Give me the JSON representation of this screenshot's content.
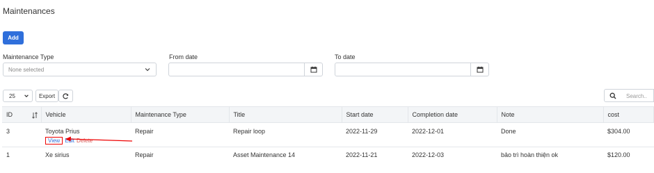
{
  "page": {
    "title": "Maintenances"
  },
  "toolbar": {
    "add_label": "Add"
  },
  "filters": {
    "type_label": "Maintenance Type",
    "type_placeholder": "None selected",
    "from_label": "From date",
    "to_label": "To date"
  },
  "table_tools": {
    "page_size": "25",
    "export_label": "Export",
    "search_placeholder": "Search.."
  },
  "table": {
    "columns": [
      "ID",
      "Vehicle",
      "Maintenance Type",
      "Title",
      "Start date",
      "Completion date",
      "Note",
      "cost"
    ],
    "rows": [
      {
        "id": "3",
        "vehicle": "Toyota Prius",
        "type": "Repair",
        "title": "Repair loop",
        "start": "2022-11-29",
        "completion": "2022-12-01",
        "note": "Done",
        "cost": "$304.00",
        "actions": {
          "view": "View",
          "edit": "Edit",
          "delete": "Delete"
        }
      },
      {
        "id": "1",
        "vehicle": "Xe sirius",
        "type": "Repair",
        "title": "Asset Maintenance 14",
        "start": "2022-11-21",
        "completion": "2022-12-03",
        "note": "bảo trì hoàn thiện ok",
        "cost": "$120.00"
      }
    ]
  },
  "colors": {
    "primary": "#2f6fdb",
    "highlight": "#e00000",
    "danger": "#d9534f"
  }
}
